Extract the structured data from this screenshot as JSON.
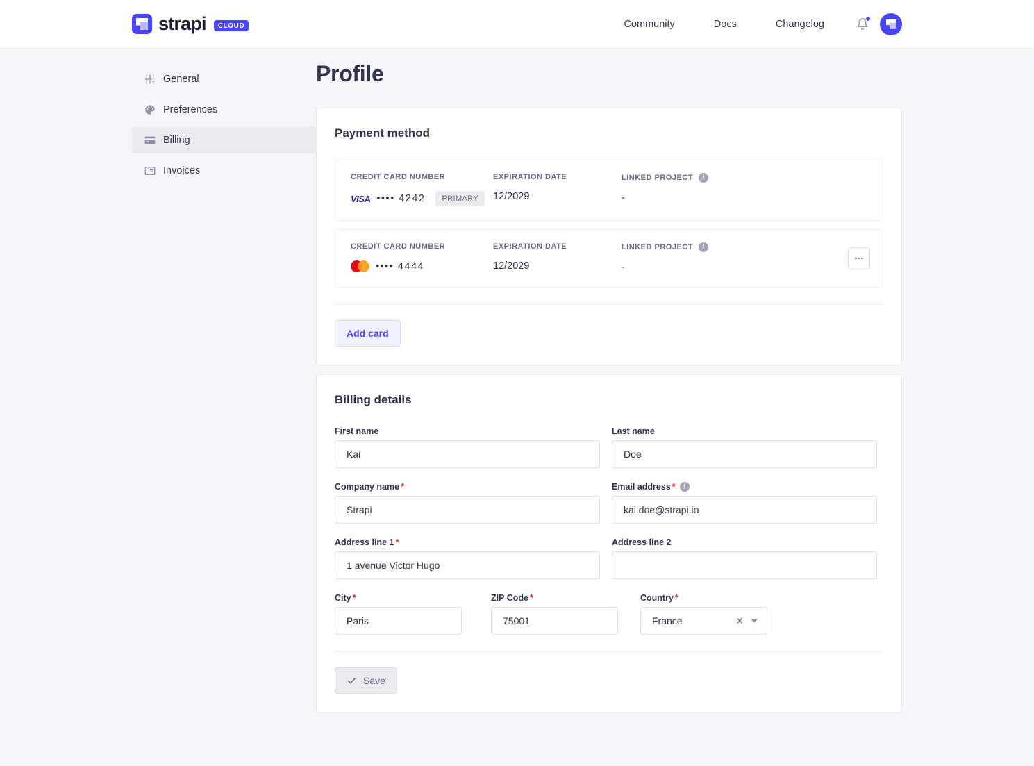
{
  "header": {
    "brand_name": "strapi",
    "brand_badge": "CLOUD",
    "nav": [
      {
        "label": "Community"
      },
      {
        "label": "Docs"
      },
      {
        "label": "Changelog"
      }
    ]
  },
  "sidebar": {
    "items": [
      {
        "label": "General",
        "icon": "sliders-icon",
        "active": false
      },
      {
        "label": "Preferences",
        "icon": "palette-icon",
        "active": false
      },
      {
        "label": "Billing",
        "icon": "credit-card-icon",
        "active": true
      },
      {
        "label": "Invoices",
        "icon": "receipt-icon",
        "active": false
      }
    ]
  },
  "main": {
    "page_title": "Profile",
    "payment": {
      "title": "Payment method",
      "columns": {
        "number": "CREDIT CARD NUMBER",
        "expiration": "EXPIRATION DATE",
        "linked_project": "LINKED PROJECT"
      },
      "cards": [
        {
          "brand": "visa",
          "brand_label": "VISA",
          "masked": "•••• 4242",
          "badge": "PRIMARY",
          "expiration": "12/2029",
          "linked_project": "-",
          "has_menu": false
        },
        {
          "brand": "mastercard",
          "brand_label": "",
          "masked": "•••• 4444",
          "badge": "",
          "expiration": "12/2029",
          "linked_project": "-",
          "has_menu": true
        }
      ],
      "add_card_label": "Add card"
    },
    "billing": {
      "title": "Billing details",
      "fields": {
        "first_name": {
          "label": "First name",
          "required": false,
          "value": "Kai"
        },
        "last_name": {
          "label": "Last name",
          "required": false,
          "value": "Doe"
        },
        "company_name": {
          "label": "Company name",
          "required": true,
          "value": "Strapi"
        },
        "email": {
          "label": "Email address",
          "required": true,
          "value": "kai.doe@strapi.io",
          "info": true
        },
        "address1": {
          "label": "Address line 1",
          "required": true,
          "value": "1 avenue Victor Hugo"
        },
        "address2": {
          "label": "Address line 2",
          "required": false,
          "value": ""
        },
        "city": {
          "label": "City",
          "required": true,
          "value": "Paris"
        },
        "zip": {
          "label": "ZIP Code",
          "required": true,
          "value": "75001"
        },
        "country": {
          "label": "Country",
          "required": true,
          "value": "France"
        }
      },
      "save_label": "Save"
    }
  },
  "colors": {
    "accent": "#4945ff",
    "page_bg": "#f6f6f9",
    "text": "#32324d",
    "muted": "#666687",
    "required": "#d02b20",
    "visa": "#1a1f71",
    "mastercard_left": "#eb001b",
    "mastercard_right": "#f79e1b"
  }
}
